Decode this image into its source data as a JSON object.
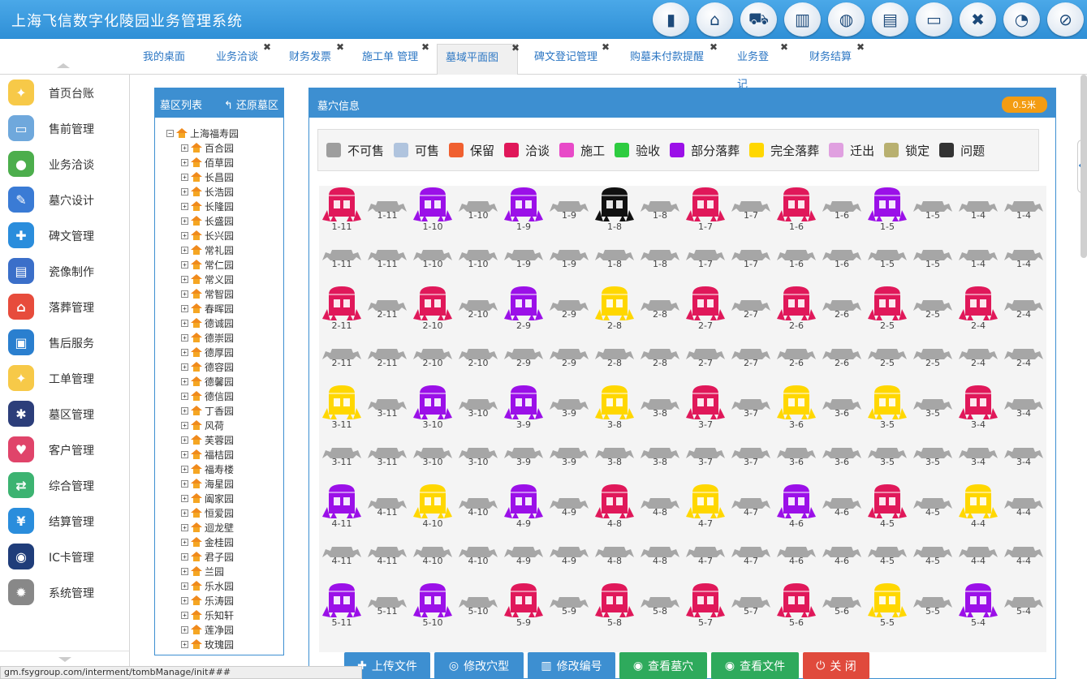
{
  "app": {
    "title": "上海飞信数字化陵园业务管理系统"
  },
  "header_icons": [
    "chart-icon",
    "home-icon",
    "cart-icon",
    "buildings-icon",
    "globe-icon",
    "badge-icon",
    "monitor-icon",
    "close-icon",
    "rss-icon",
    "power-icon"
  ],
  "tabs": [
    {
      "label": "我的桌面",
      "closable": false
    },
    {
      "label": "业务洽谈",
      "closable": true
    },
    {
      "label": "财务发票",
      "closable": true
    },
    {
      "label": "施工单 管理",
      "closable": true
    },
    {
      "label": "墓域平面图",
      "closable": true,
      "active": true
    },
    {
      "label": "碑文登记管理",
      "closable": true
    },
    {
      "label": "购墓未付款提醒",
      "closable": true
    },
    {
      "label": "业务登记",
      "closable": true
    },
    {
      "label": "财务结算",
      "closable": true
    }
  ],
  "sidebar": {
    "items": [
      {
        "label": "首页台账",
        "icon": "bulb-icon",
        "color": "#f7c948"
      },
      {
        "label": "售前管理",
        "icon": "monitor-icon",
        "color": "#6fa8dc"
      },
      {
        "label": "业务洽谈",
        "icon": "user-icon",
        "color": "#4cae4c"
      },
      {
        "label": "墓穴设计",
        "icon": "pen-icon",
        "color": "#3a7bd5"
      },
      {
        "label": "碑文管理",
        "icon": "wrench-icon",
        "color": "#2a8ddc"
      },
      {
        "label": "瓷像制作",
        "icon": "document-icon",
        "color": "#3b6fc9"
      },
      {
        "label": "落葬管理",
        "icon": "home-icon",
        "color": "#e74c3c"
      },
      {
        "label": "售后服务",
        "icon": "bag-icon",
        "color": "#2a7fcf"
      },
      {
        "label": "工单管理",
        "icon": "bulb-icon",
        "color": "#f7c948"
      },
      {
        "label": "墓区管理",
        "icon": "network-icon",
        "color": "#2c3e7a"
      },
      {
        "label": "客户管理",
        "icon": "heart-icon",
        "color": "#e0446a"
      },
      {
        "label": "综合管理",
        "icon": "shuffle-icon",
        "color": "#3cb371"
      },
      {
        "label": "结算管理",
        "icon": "yen-icon",
        "color": "#2a8ddc"
      },
      {
        "label": "IC卡管理",
        "icon": "card-icon",
        "color": "#1f3d7a"
      },
      {
        "label": "系统管理",
        "icon": "gear-icon",
        "color": "#888888"
      }
    ]
  },
  "tree": {
    "title": "墓区列表",
    "restore_label": "还原墓区",
    "root": "上海福寿园",
    "nodes": [
      "百合园",
      "佰草园",
      "长昌园",
      "长浩园",
      "长隆园",
      "长盛园",
      "长兴园",
      "常礼园",
      "常仁园",
      "常义园",
      "常智园",
      "春晖园",
      "德诚园",
      "德崇园",
      "德厚园",
      "德容园",
      "德馨园",
      "德信园",
      "丁香园",
      "风荷",
      "芙蓉园",
      "福桔园",
      "福寿楼",
      "海星园",
      "阖家园",
      "恒爱园",
      "迴龙壁",
      "金桂园",
      "君子园",
      "兰园",
      "乐水园",
      "乐涛园",
      "乐知轩",
      "莲净园",
      "玫瑰园"
    ]
  },
  "info": {
    "title": "墓穴信息",
    "scale": "0.5米"
  },
  "legend": [
    {
      "label": "不可售",
      "color": "#9e9e9e"
    },
    {
      "label": "可售",
      "color": "#b0c4de"
    },
    {
      "label": "保留",
      "color": "#f06030"
    },
    {
      "label": "洽谈",
      "color": "#e0185a"
    },
    {
      "label": "施工",
      "color": "#e84ac8"
    },
    {
      "label": "验收",
      "color": "#2ecc40"
    },
    {
      "label": "部分落葬",
      "color": "#9b10e8"
    },
    {
      "label": "完全落葬",
      "color": "#ffd700"
    },
    {
      "label": "迁出",
      "color": "#e0a0e0"
    },
    {
      "label": "锁定",
      "color": "#b8b070"
    },
    {
      "label": "问题",
      "color": "#333333"
    }
  ],
  "status_colors": {
    "t": "#e0185a",
    "p": "#9b10e8",
    "y": "#ffd700",
    "k": "#111111"
  },
  "grid_rows": [
    {
      "type": "tomb",
      "row": "1",
      "tombs": [
        "t",
        "p",
        "p",
        "k",
        "t",
        "t",
        "p"
      ]
    },
    {
      "type": "slab",
      "row": "1"
    },
    {
      "type": "tomb",
      "row": "2",
      "tombs": [
        "t",
        "t",
        "p",
        "y",
        "t",
        "t",
        "t",
        "t"
      ]
    },
    {
      "type": "slab",
      "row": "2"
    },
    {
      "type": "tomb",
      "row": "3",
      "tombs": [
        "y",
        "p",
        "p",
        "y",
        "t",
        "y",
        "y",
        "t"
      ]
    },
    {
      "type": "slab",
      "row": "3"
    },
    {
      "type": "tomb",
      "row": "4",
      "tombs": [
        "p",
        "y",
        "p",
        "t",
        "y",
        "p",
        "t",
        "y"
      ]
    },
    {
      "type": "slab",
      "row": "4"
    },
    {
      "type": "tomb",
      "row": "5",
      "tombs": [
        "p",
        "p",
        "t",
        "t",
        "t",
        "t",
        "y",
        "p"
      ]
    }
  ],
  "row1_numbers": [
    "11",
    "10",
    "9",
    "8",
    "7",
    "6",
    "5",
    "4"
  ],
  "buttons": [
    {
      "label": "上传文件",
      "icon": "✚",
      "color": "#3d8fd1"
    },
    {
      "label": "修改穴型",
      "icon": "◎",
      "color": "#3d8fd1"
    },
    {
      "label": "修改编号",
      "icon": "▥",
      "color": "#3d8fd1"
    },
    {
      "label": "查看墓穴",
      "icon": "◉",
      "color": "#2eaa5c"
    },
    {
      "label": "查看文件",
      "icon": "◉",
      "color": "#2eaa5c"
    },
    {
      "label": "关 闭",
      "icon": "⏻",
      "color": "#e04a3c"
    }
  ],
  "status_url": "gm.fsygroup.com/interment/tombManage/init###"
}
